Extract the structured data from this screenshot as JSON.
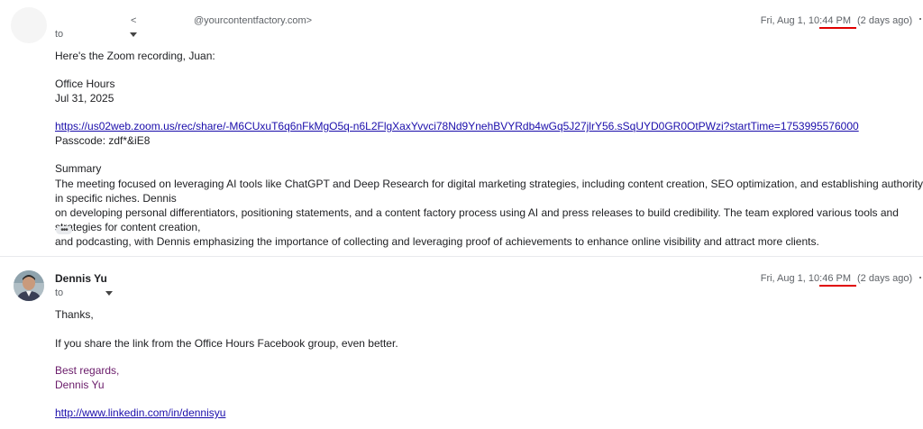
{
  "message1": {
    "sender_email": "@yourcontentfactory.com>",
    "sender_lt": "<",
    "to_label": "to",
    "date": "Fri, Aug 1, 10:44 PM",
    "relative": "(2 days ago)",
    "greeting": "Here's the Zoom recording, Juan:",
    "meeting_title": "Office Hours",
    "meeting_date": "Jul 31, 2025",
    "recording_link": "https://us02web.zoom.us/rec/share/-M6CUxuT6q6nFkMgO5q-n6L2FlgXaxYvvci78Nd9YnehBVYRdb4wGq5J27jlrY56.sSqUYD0GR0OtPWzi?startTime=1753995576000",
    "passcode": "Passcode: zdf*&iE8",
    "summary_heading": "Summary",
    "summary_lines": [
      "The meeting focused on leveraging AI tools like ChatGPT and Deep Research for digital marketing strategies, including content creation, SEO optimization, and establishing authority in specific niches. Dennis",
      "on developing personal differentiators, positioning statements, and a content factory process using AI and press releases to build credibility. The team explored various tools and strategies for content creation,",
      "and podcasting, with Dennis emphasizing the importance of collecting and leveraging proof of achievements to enhance online visibility and attract more clients."
    ],
    "trimmed_content": "•••"
  },
  "message2": {
    "sender_name": "Dennis Yu",
    "to_label": "to",
    "date": "Fri, Aug 1, 10:46 PM",
    "relative": "(2 days ago)",
    "greeting": "Thanks,",
    "body": "If you share the link from the Office Hours Facebook group, even better.",
    "signoff": "Best regards,",
    "signature_name": "Dennis Yu",
    "linkedin": "http://www.linkedin.com/in/dennisyu"
  },
  "colors": {
    "link": "#1a0dab",
    "signature": "#6a1b6a",
    "highlight_underline": "#e00000"
  }
}
